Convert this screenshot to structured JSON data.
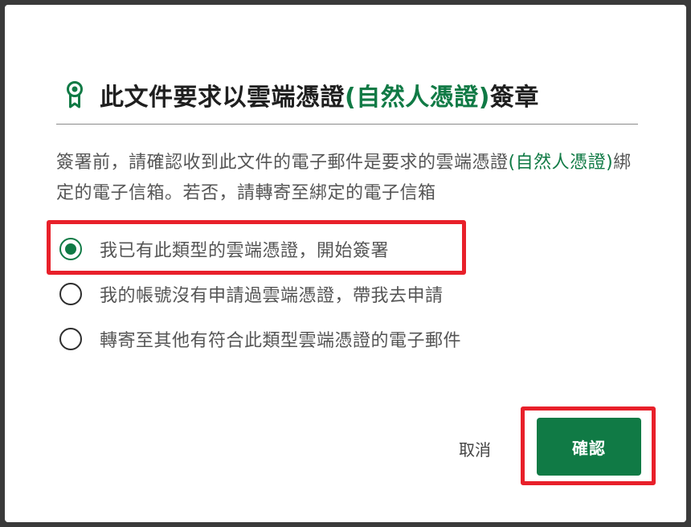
{
  "dialog": {
    "title_main": "此文件要求以雲端憑證",
    "title_accent": "(自然人憑證)",
    "title_suffix": "簽章",
    "desc_part1": "簽署前，請確認收到此文件的電子郵件是要求的雲端憑證",
    "desc_accent": "(自然人憑證)",
    "desc_part2": "綁定的電子信箱。若否，請轉寄至綁定的電子信箱",
    "options": [
      {
        "label": "我已有此類型的雲端憑證，開始簽署",
        "selected": true
      },
      {
        "label": "我的帳號沒有申請過雲端憑證，帶我去申請",
        "selected": false
      },
      {
        "label": "轉寄至其他有符合此類型雲端憑證的電子郵件",
        "selected": false
      }
    ],
    "cancel_label": "取消",
    "confirm_label": "確認"
  },
  "icons": {
    "header": "certificate-ribbon-icon"
  },
  "colors": {
    "accent": "#107a45",
    "highlight": "#e8202a",
    "title_text": "#1f1f1f",
    "body_text": "#555555"
  }
}
